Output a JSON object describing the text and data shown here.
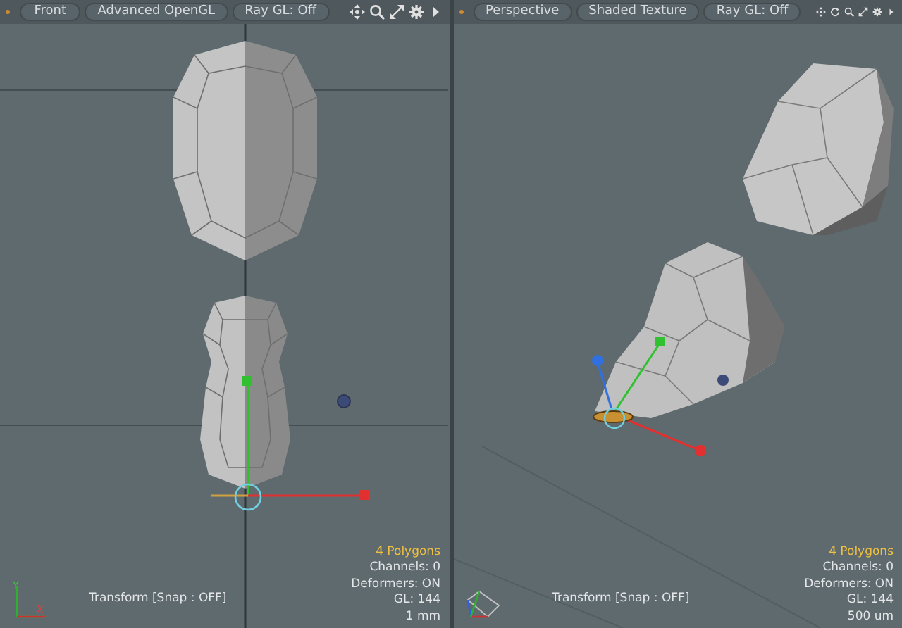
{
  "viewports": [
    {
      "kind": "front",
      "buttons": [
        {
          "label": "Front"
        },
        {
          "label": "Advanced OpenGL"
        },
        {
          "label": "Ray GL: Off"
        }
      ],
      "tool_label": "Transform [Snap : OFF]",
      "stats": [
        "4 Polygons",
        "Channels: 0",
        "Deformers: ON",
        "GL: 144",
        "1 mm"
      ],
      "axis_labels": [
        "Y",
        "X"
      ]
    },
    {
      "kind": "perspective",
      "buttons": [
        {
          "label": "Perspective"
        },
        {
          "label": "Shaded Texture"
        },
        {
          "label": "Ray GL: Off"
        }
      ],
      "tool_label": "Transform [Snap : OFF]",
      "stats": [
        "4 Polygons",
        "Channels: 0",
        "Deformers: ON",
        "GL: 144",
        "500 um"
      ]
    }
  ]
}
